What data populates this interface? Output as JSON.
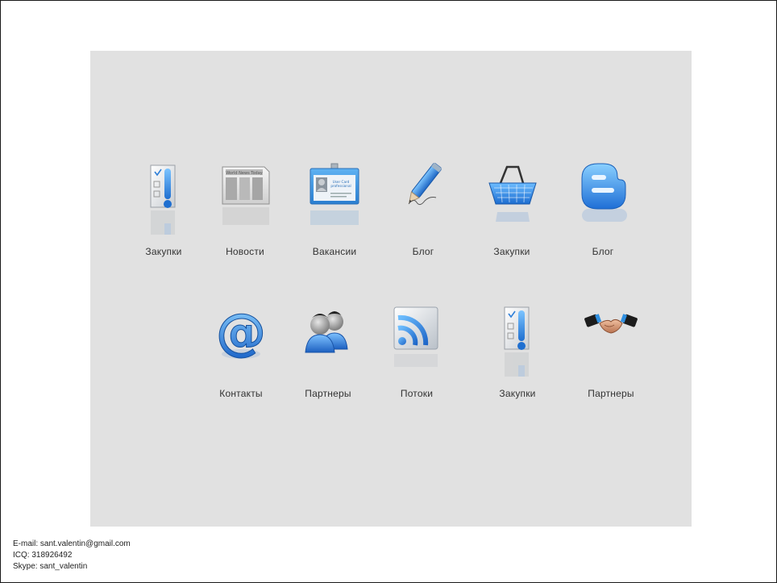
{
  "row1": [
    {
      "label": "Закупки",
      "icon": "checklist-icon"
    },
    {
      "label": "Новости",
      "icon": "newspaper-icon"
    },
    {
      "label": "Вакансии",
      "icon": "badge-icon"
    },
    {
      "label": "Блог",
      "icon": "pencil-icon"
    },
    {
      "label": "Закупки",
      "icon": "basket-icon"
    },
    {
      "label": "Блог",
      "icon": "blogger-icon"
    }
  ],
  "row2": [
    {
      "label": "Контакты",
      "icon": "at-sign-icon"
    },
    {
      "label": "Партнеры",
      "icon": "people-icon"
    },
    {
      "label": "Потоки",
      "icon": "rss-icon"
    },
    {
      "label": "Закупки",
      "icon": "checklist-icon"
    },
    {
      "label": "Партнеры",
      "icon": "handshake-icon"
    }
  ],
  "icon_texts": {
    "newspaper_masthead": "World News Today",
    "badge_line1": "User Card",
    "badge_line2": "professional"
  },
  "footer": {
    "email": "E-mail: sant.valentin@gmail.com",
    "icq": "ICQ: 318926492",
    "skype": "Skype: sant_valentin"
  },
  "colors": {
    "panel": "#e1e1e1",
    "accent_blue": "#2f8fe0",
    "text": "#333333"
  }
}
